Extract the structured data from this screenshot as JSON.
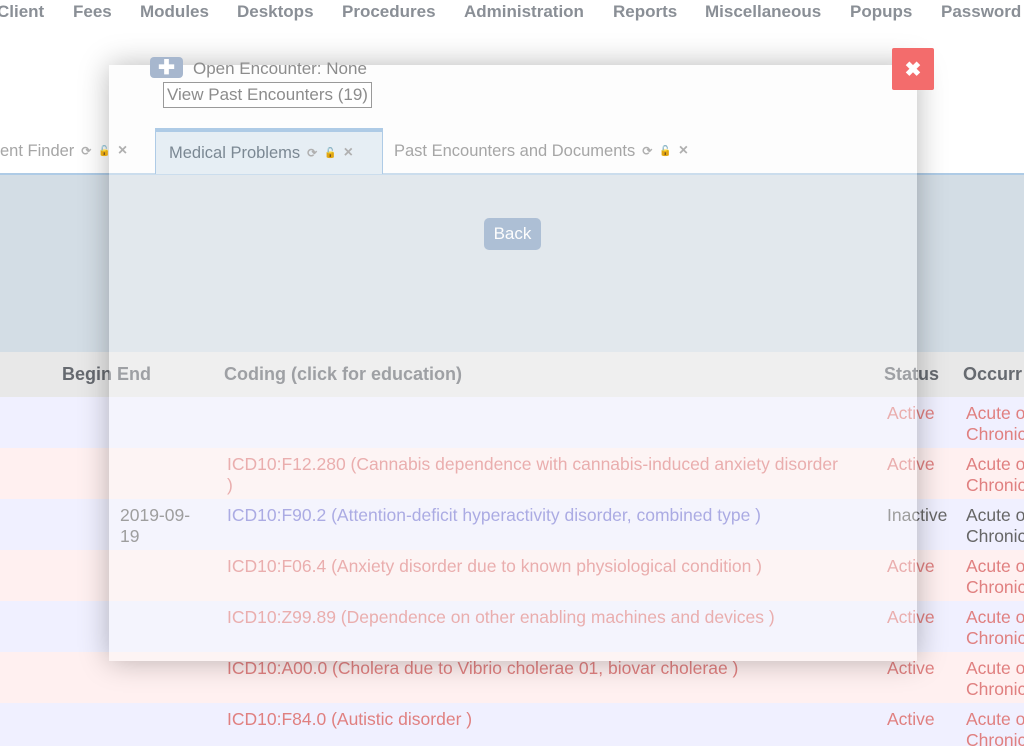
{
  "menu": [
    "Client",
    "Fees",
    "Modules",
    "Desktops",
    "Procedures",
    "Administration",
    "Reports",
    "Miscellaneous",
    "Popups",
    "Password"
  ],
  "modal": {
    "open_encounter": "Open Encounter: None",
    "view_past": "View Past Encounters (19)",
    "close_icon": "✖",
    "plus_icon": "✚"
  },
  "tabs": [
    {
      "label": "ent Finder"
    },
    {
      "label": "Medical Problems"
    },
    {
      "label": "Past Encounters and Documents"
    }
  ],
  "tab_icons": {
    "refresh": "⟳",
    "lock": "🔓",
    "close": "×"
  },
  "back_label": "Back",
  "table": {
    "headers": {
      "begin_end": "Begin End",
      "coding": "Coding (click for education)",
      "status": "Status",
      "occurrence": "Occurr"
    },
    "rows": [
      {
        "begin": "",
        "code": "",
        "status": "Active",
        "occ1": "Acute o",
        "occ2": "Chronic"
      },
      {
        "begin": "",
        "code": "ICD10:F12.280 (Cannabis dependence with cannabis-induced anxiety disorder )",
        "status": "Active",
        "occ1": "Acute o",
        "occ2": "Chronic"
      },
      {
        "begin": "2019-09-19",
        "code": "ICD10:F90.2 (Attention-deficit hyperactivity disorder, combined type )",
        "status": "Inactive",
        "occ1": "Acute o",
        "occ2": "Chronic"
      },
      {
        "begin": "",
        "code": "ICD10:F06.4 (Anxiety disorder due to known physiological condition )",
        "status": "Active",
        "occ1": "Acute o",
        "occ2": "Chronic"
      },
      {
        "begin": "",
        "code": "ICD10:Z99.89 (Dependence on other enabling machines and devices )",
        "status": "Active",
        "occ1": "Acute o",
        "occ2": "Chronic"
      },
      {
        "begin": "",
        "code": "ICD10:A00.0 (Cholera due to Vibrio cholerae 01, biovar cholerae )",
        "status": "Active",
        "occ1": "Acute o",
        "occ2": "Chronic"
      },
      {
        "begin": "",
        "code": "ICD10:F84.0 (Autistic disorder )",
        "status": "Active",
        "occ1": "Acute o",
        "occ2": "Chronic"
      }
    ]
  }
}
